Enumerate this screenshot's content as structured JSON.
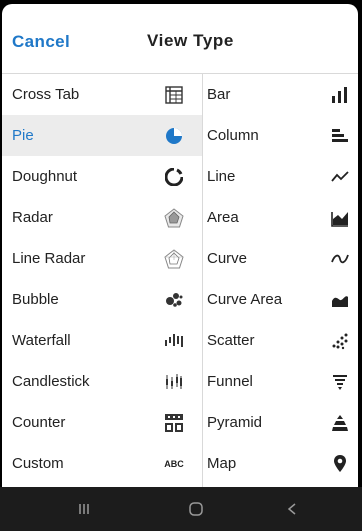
{
  "header": {
    "cancel_label": "Cancel",
    "title": "View Type"
  },
  "left_column": [
    {
      "label": "Cross Tab",
      "icon": "cross-tab-icon",
      "selected": false
    },
    {
      "label": "Pie",
      "icon": "pie-icon",
      "selected": true
    },
    {
      "label": "Doughnut",
      "icon": "doughnut-icon",
      "selected": false
    },
    {
      "label": "Radar",
      "icon": "radar-icon",
      "selected": false
    },
    {
      "label": "Line Radar",
      "icon": "line-radar-icon",
      "selected": false
    },
    {
      "label": "Bubble",
      "icon": "bubble-icon",
      "selected": false
    },
    {
      "label": "Waterfall",
      "icon": "waterfall-icon",
      "selected": false
    },
    {
      "label": "Candlestick",
      "icon": "candlestick-icon",
      "selected": false
    },
    {
      "label": "Counter",
      "icon": "counter-icon",
      "selected": false
    },
    {
      "label": "Custom",
      "icon": "custom-abc-icon",
      "icon_text": "ABC",
      "selected": false
    }
  ],
  "right_column": [
    {
      "label": "Bar",
      "icon": "bar-icon"
    },
    {
      "label": "Column",
      "icon": "column-icon"
    },
    {
      "label": "Line",
      "icon": "line-icon"
    },
    {
      "label": "Area",
      "icon": "area-icon"
    },
    {
      "label": "Curve",
      "icon": "curve-icon"
    },
    {
      "label": "Curve Area",
      "icon": "curve-area-icon"
    },
    {
      "label": "Scatter",
      "icon": "scatter-icon"
    },
    {
      "label": "Funnel",
      "icon": "funnel-icon"
    },
    {
      "label": "Pyramid",
      "icon": "pyramid-icon"
    },
    {
      "label": "Map",
      "icon": "map-pin-icon"
    }
  ],
  "nav_bar": {
    "buttons": [
      "recent-apps-icon",
      "home-icon",
      "back-icon"
    ]
  },
  "colors": {
    "accent": "#1f78c8",
    "selected_bg": "#ececec",
    "icon": "#222222",
    "nav_bg": "#1c1c1c"
  }
}
